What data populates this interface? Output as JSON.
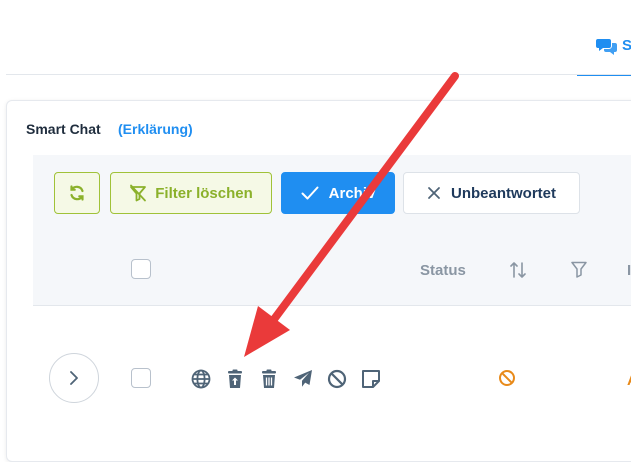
{
  "tabs": {
    "smart_chat_label": "S"
  },
  "card": {
    "title": "Smart Chat",
    "help_link": "(Erklärung)"
  },
  "toolbar": {
    "filter_clear_label": "Filter löschen",
    "archive_label": "Archiv",
    "unanswered_label": "Unbeantwortet"
  },
  "table": {
    "headers": {
      "status": "Status",
      "next_col_partial": "I"
    },
    "row": {
      "next_col_partial": "A"
    }
  },
  "colors": {
    "accent_blue": "#1f8ef1",
    "lime_green": "#8bb12b",
    "icon_slate": "#4f6477",
    "warning_orange": "#e88a1a",
    "annotation_red": "#ea3a3a"
  },
  "icons": {
    "tab": "comments-icon",
    "refresh": "refresh-icon",
    "filter_clear": "filter-slash-icon",
    "archive": "check-icon",
    "unanswered": "x-icon",
    "sort": "sort-arrows-icon",
    "filter": "funnel-icon",
    "expand": "chevron-right-icon",
    "row_actions": [
      "globe-icon",
      "restore-trash-icon",
      "trash-icon",
      "send-icon",
      "ban-icon",
      "note-icon"
    ],
    "status": "ban-icon"
  }
}
